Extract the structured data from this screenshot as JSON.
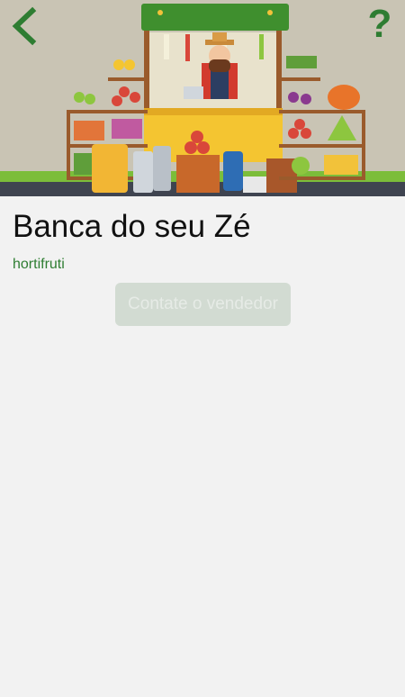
{
  "header": {
    "back_icon": "chevron-left-icon",
    "help_label": "?",
    "accent_color": "#2e7d32"
  },
  "stall": {
    "name": "Banca do seu Zé",
    "category": "hortifruti"
  },
  "actions": {
    "contact_label": "Contate o vendedor",
    "contact_enabled": false
  }
}
